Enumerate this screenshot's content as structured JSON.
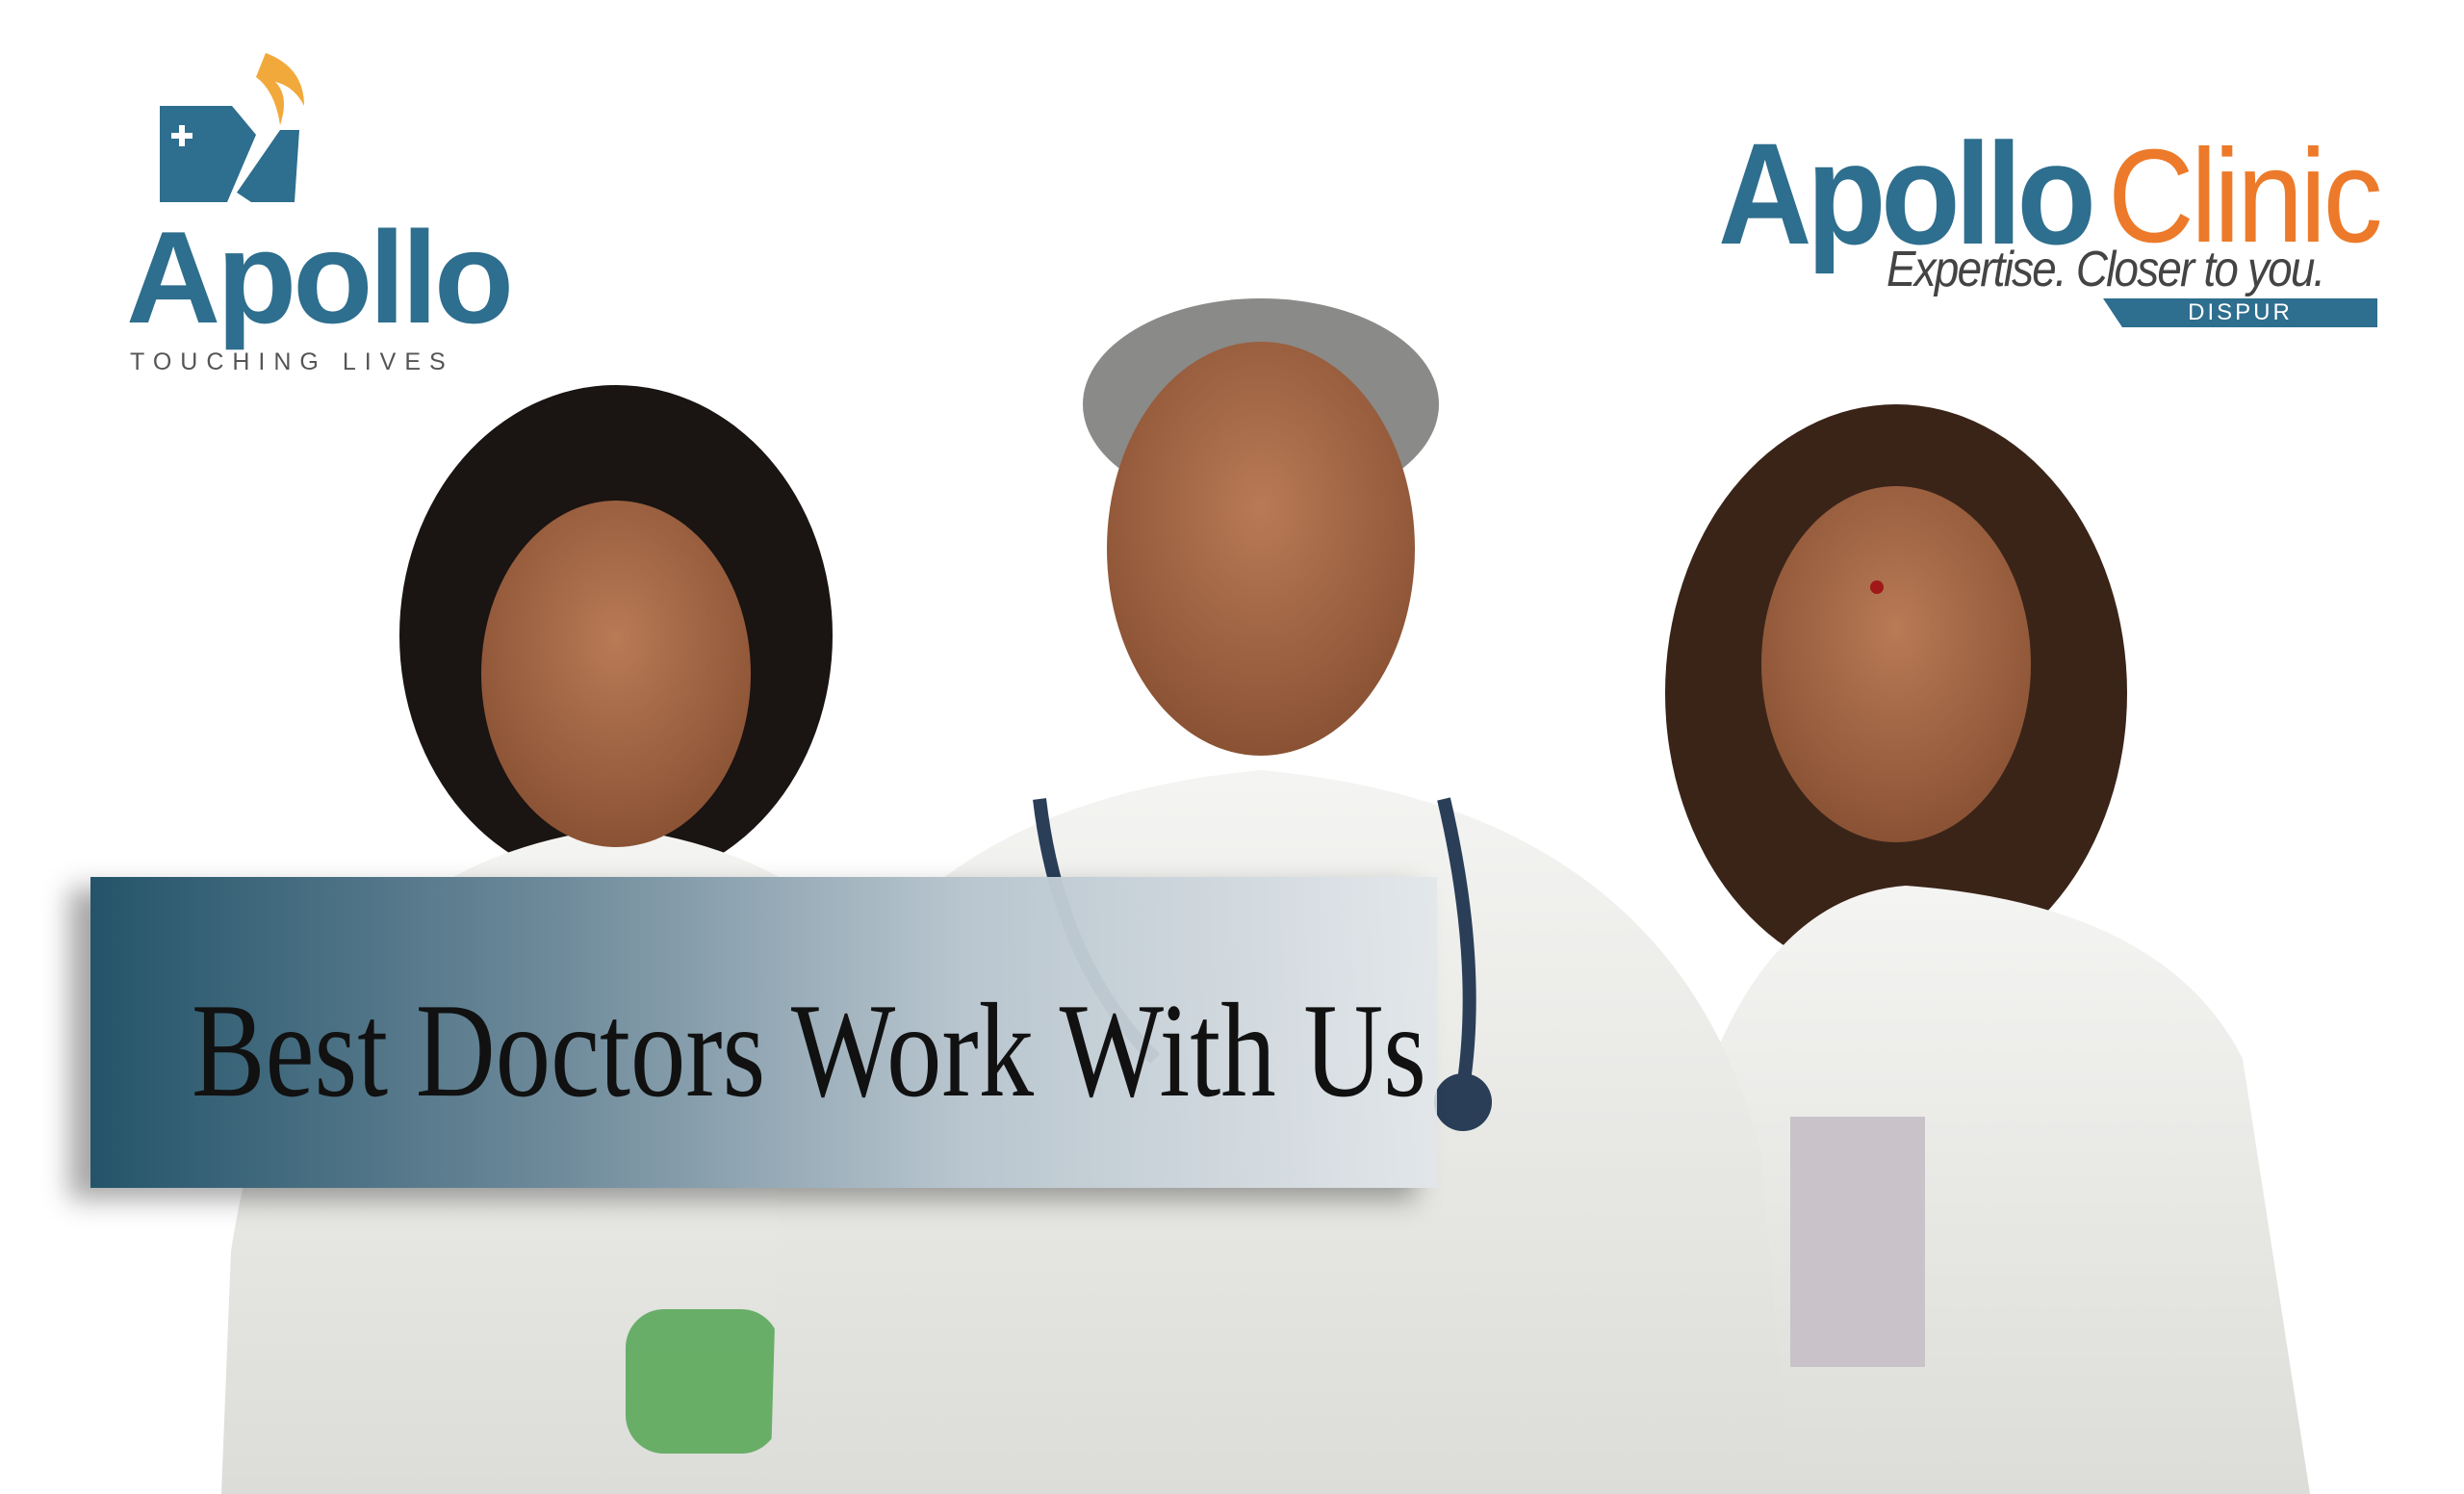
{
  "brand": {
    "primary_color": "#2e6e8e",
    "accent_color": "#ec7a2a",
    "flame_color": "#f2a93b"
  },
  "logo_left": {
    "wordmark": "Apollo",
    "tagline": "TOUCHING LIVES"
  },
  "logo_right": {
    "wordmark_primary": "Apollo",
    "wordmark_secondary": "Clinic",
    "slogan": "Expertise. Closer to you.",
    "location": "DISPUR"
  },
  "banner": {
    "headline": "Best Doctors Work With Us"
  },
  "photo": {
    "subject": "three-doctors-in-white-coats"
  }
}
